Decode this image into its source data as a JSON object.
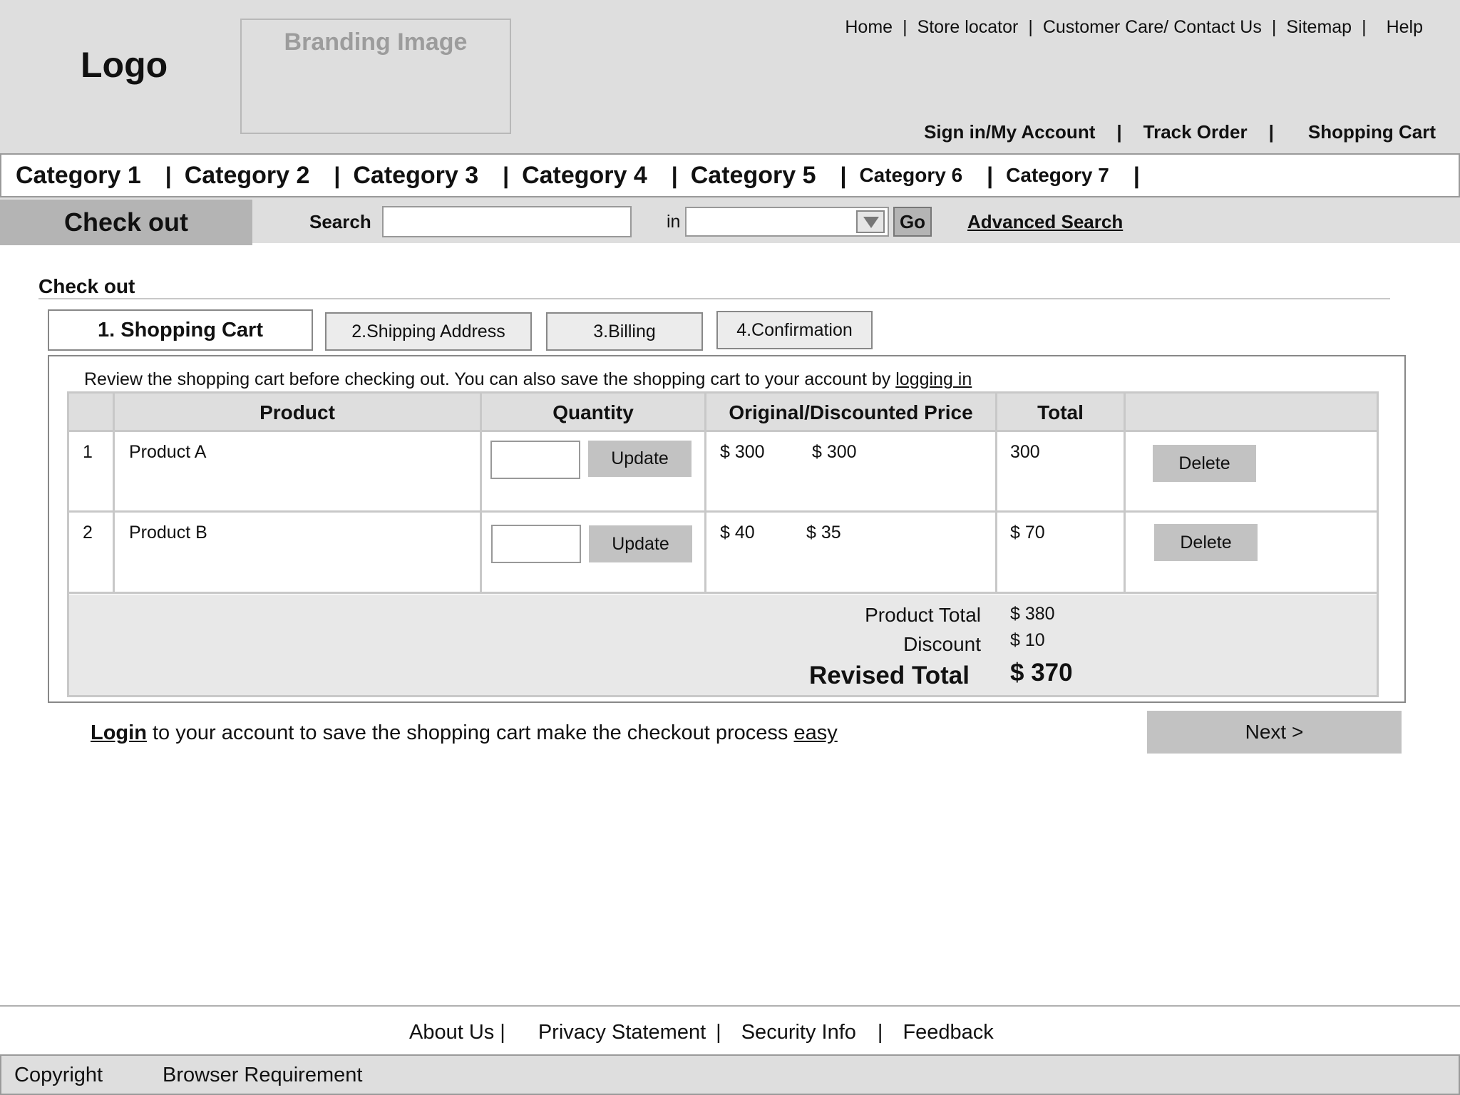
{
  "header": {
    "logo": "Logo",
    "branding": "Branding Image",
    "top_links": [
      "Home",
      "Store locator",
      "Customer Care/ Contact Us",
      "Sitemap",
      "Help"
    ],
    "account_links": [
      "Sign in/My Account",
      "Track Order",
      "Shopping Cart"
    ]
  },
  "categories": [
    "Category 1",
    "Category 2",
    "Category 3",
    "Category 4",
    "Category 5",
    "Category 6",
    "Category 7"
  ],
  "search": {
    "section_label": "Check out",
    "label": "Search",
    "value": "",
    "in_label": "in",
    "scope_value": "",
    "go_label": "Go",
    "advanced_label": "Advanced Search"
  },
  "checkout": {
    "title": "Check out",
    "tabs": [
      "1. Shopping Cart",
      "2.Shipping Address",
      "3.Billing",
      "4.Confirmation"
    ],
    "intro_text": "Review the shopping cart before checking out. You can also save the shopping cart to your account by ",
    "intro_link": "logging in",
    "columns": [
      "Product",
      "Quantity",
      "Original/Discounted Price",
      "Total"
    ],
    "rows": [
      {
        "num": "1",
        "product": "Product A",
        "qty": "",
        "update": "Update",
        "original": "$ 300",
        "discounted": "$ 300",
        "total": "300",
        "delete": "Delete"
      },
      {
        "num": "2",
        "product": "Product B",
        "qty": "",
        "update": "Update",
        "original": "$ 40",
        "discounted": "$ 35",
        "total": "$ 70",
        "delete": "Delete"
      }
    ],
    "totals": {
      "product_total_label": "Product Total",
      "product_total": "$ 380",
      "discount_label": "Discount",
      "discount": "$ 10",
      "revised_total_label": "Revised Total",
      "revised_total": "$ 370"
    },
    "login_link": "Login",
    "login_text": " to your account to save the shopping cart make the checkout process ",
    "easy_link": "easy",
    "next_label": "Next >"
  },
  "footer": {
    "links": [
      "About Us",
      "Privacy Statement",
      "Security Info",
      "Feedback"
    ],
    "copyright": "Copyright",
    "browser_requirement": "Browser Requirement"
  }
}
